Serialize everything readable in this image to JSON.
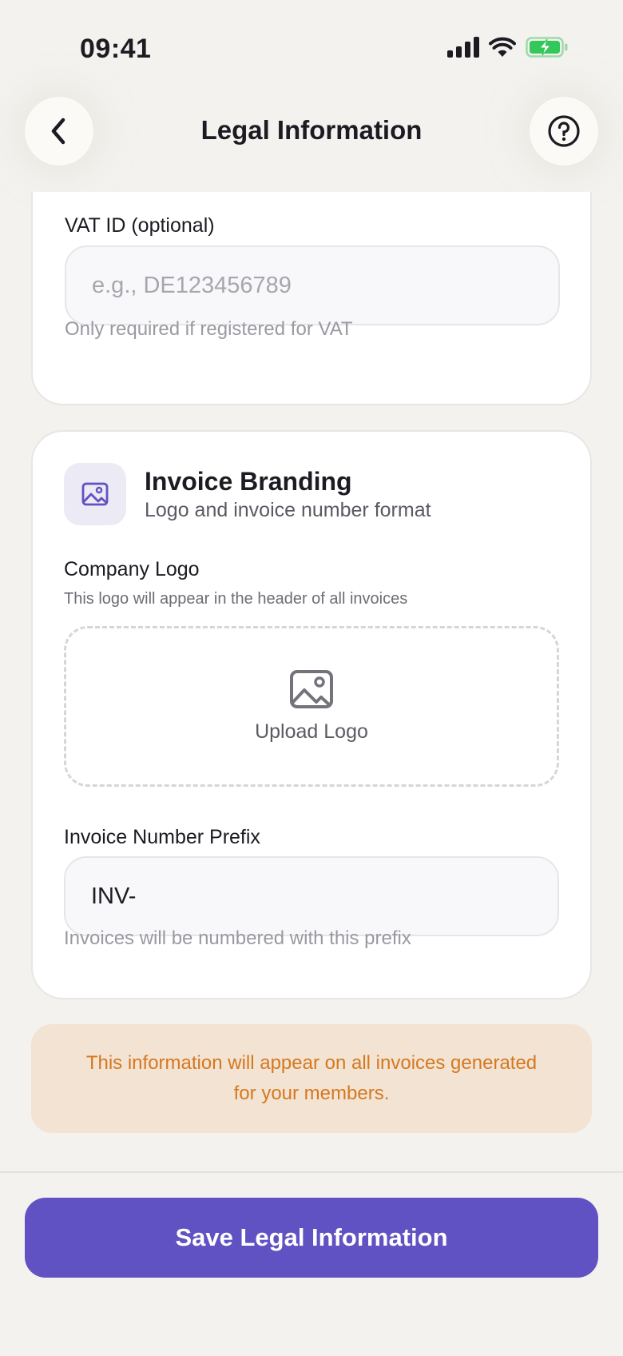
{
  "status_bar": {
    "time": "09:41",
    "icons": [
      "cellular-signal-icon",
      "wifi-icon",
      "battery-charging-icon"
    ],
    "battery_color": "#34c759"
  },
  "header": {
    "title": "Legal Information",
    "back_icon": "chevron-left-icon",
    "help_icon": "help-circle-icon"
  },
  "vat_section": {
    "label": "VAT ID (optional)",
    "placeholder": "e.g., DE123456789",
    "hint": "Only required if registered for VAT"
  },
  "branding_section": {
    "icon": "image-icon",
    "title": "Invoice Branding",
    "subtitle": "Logo and invoice number format",
    "logo_label": "Company Logo",
    "logo_hint": "This logo will appear in the header of all invoices",
    "upload_icon": "image-icon",
    "upload_label": "Upload Logo",
    "prefix_label": "Invoice Number Prefix",
    "prefix_value": "INV-",
    "prefix_hint": "Invoices will be numbered with this prefix"
  },
  "notice": {
    "text": "This information will appear on all invoices generated for your members."
  },
  "footer": {
    "save_label": "Save Legal Information"
  },
  "colors": {
    "accent": "#6152c3",
    "background": "#f3f2ef",
    "notice_bg": "#f2e3d3",
    "notice_text": "#d6781f"
  }
}
